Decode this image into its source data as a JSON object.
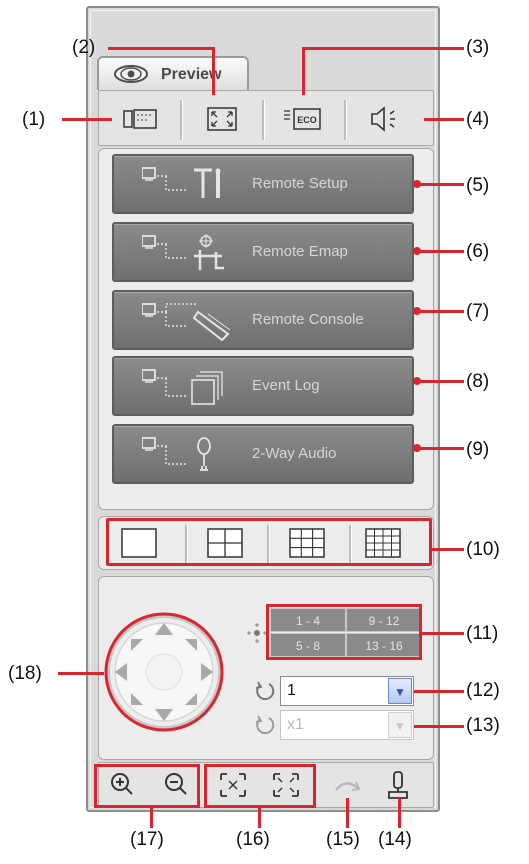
{
  "tab": {
    "label": "Preview",
    "icon": "eye-icon"
  },
  "toolbar": [
    {
      "name": "toolbar-button-1",
      "icon": "camera-view-icon"
    },
    {
      "name": "toolbar-button-2",
      "icon": "fullscreen-icon"
    },
    {
      "name": "toolbar-button-3",
      "icon": "eco-icon"
    },
    {
      "name": "toolbar-button-4",
      "icon": "audio-icon"
    }
  ],
  "menu": [
    {
      "label": "Remote Setup",
      "icon": "remote-setup-icon"
    },
    {
      "label": "Remote Emap",
      "icon": "remote-emap-icon"
    },
    {
      "label": "Remote Console",
      "icon": "remote-console-icon"
    },
    {
      "label": "Event Log",
      "icon": "event-log-icon"
    },
    {
      "label": "2-Way Audio",
      "icon": "two-way-audio-icon"
    }
  ],
  "split_modes": [
    "1x1",
    "2x2",
    "3x3",
    "4x4"
  ],
  "channels": [
    [
      "1 - 4",
      "9 - 12"
    ],
    [
      "5 - 8",
      "13 - 16"
    ]
  ],
  "selects": {
    "channel": {
      "value": "1"
    },
    "speed": {
      "value": "x1"
    }
  },
  "callouts": {
    "c1": "(1)",
    "c2": "(2)",
    "c3": "(3)",
    "c4": "(4)",
    "c5": "(5)",
    "c6": "(6)",
    "c7": "(7)",
    "c8": "(8)",
    "c9": "(9)",
    "c10": "(10)",
    "c11": "(11)",
    "c12": "(12)",
    "c13": "(13)",
    "c14": "(14)",
    "c15": "(15)",
    "c16": "(16)",
    "c17": "(17)",
    "c18": "(18)"
  },
  "colors": {
    "callout": "#d8262e",
    "menu_bg": "#7d7d7d",
    "panel": "#d9d9d9"
  }
}
